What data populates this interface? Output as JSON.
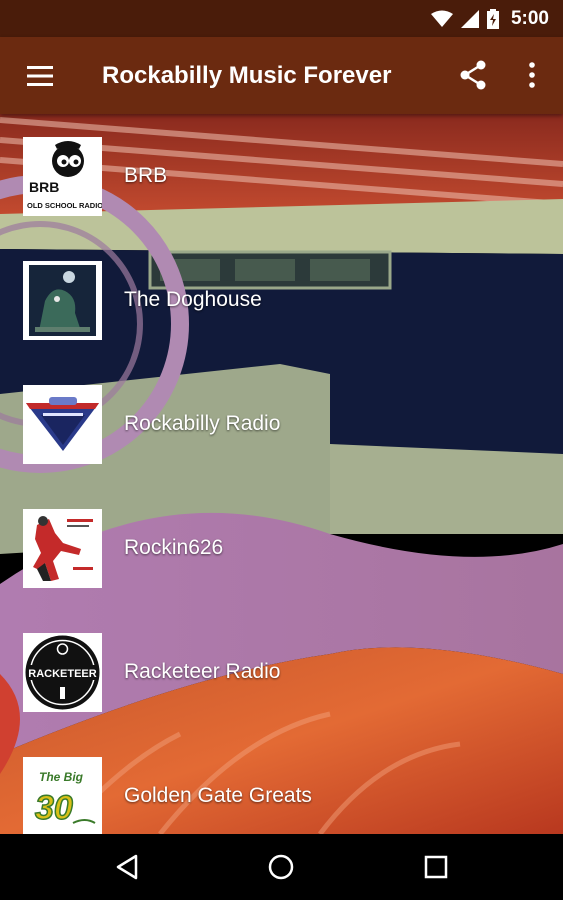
{
  "status_bar": {
    "time": "5:00",
    "icons": [
      "wifi-icon",
      "cell-signal-icon",
      "battery-charging-icon"
    ]
  },
  "toolbar": {
    "title": "Rockabilly Music Forever",
    "icons": [
      "menu-icon",
      "share-icon",
      "more-vert-icon"
    ]
  },
  "stations": [
    {
      "name": "BRB",
      "logo": "brb-logo",
      "logo_text": "BRB",
      "logo_sub": "OLD SCHOOL RADIO"
    },
    {
      "name": "The Doghouse",
      "logo": "doghouse-logo",
      "logo_text": "",
      "logo_sub": ""
    },
    {
      "name": "Rockabilly Radio",
      "logo": "rockabilly-radio-logo",
      "logo_text": "",
      "logo_sub": ""
    },
    {
      "name": "Rockin626",
      "logo": "rockin626-logo",
      "logo_text": "",
      "logo_sub": ""
    },
    {
      "name": "Racketeer Radio",
      "logo": "racketeer-radio-logo",
      "logo_text": "RACKETEER",
      "logo_sub": ""
    },
    {
      "name": "Golden Gate Greats",
      "logo": "golden-gate-greats-logo",
      "logo_text": "The Big",
      "logo_sub": "30"
    }
  ],
  "nav_bar": {
    "icons": [
      "back-icon",
      "home-icon",
      "recents-icon"
    ]
  },
  "colors": {
    "status_bar": "#4a1c0a",
    "toolbar": "#6b2a10",
    "nav_bar": "#000000"
  }
}
